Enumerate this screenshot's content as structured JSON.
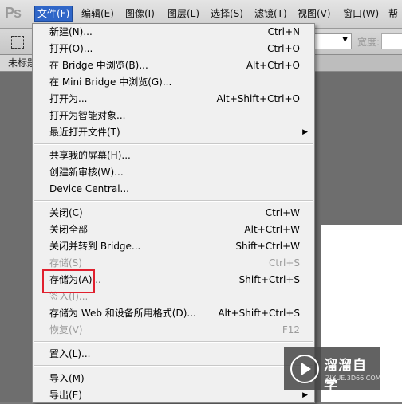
{
  "app": {
    "logo": "Ps"
  },
  "menubar": {
    "items": [
      {
        "label": "文件(F)"
      },
      {
        "label": "编辑(E)"
      },
      {
        "label": "图像(I)"
      },
      {
        "label": "图层(L)"
      },
      {
        "label": "选择(S)"
      },
      {
        "label": "滤镜(T)"
      },
      {
        "label": "视图(V)"
      },
      {
        "label": "窗口(W)"
      },
      {
        "label": "帮"
      }
    ]
  },
  "optionsbar": {
    "width_label": "宽度:"
  },
  "document": {
    "tab_label": "未标题"
  },
  "file_menu": {
    "items": [
      {
        "label": "新建(N)...",
        "shortcut": "Ctrl+N"
      },
      {
        "label": "打开(O)...",
        "shortcut": "Ctrl+O"
      },
      {
        "label": "在 Bridge 中浏览(B)...",
        "shortcut": "Alt+Ctrl+O"
      },
      {
        "label": "在 Mini Bridge 中浏览(G)...",
        "shortcut": ""
      },
      {
        "label": "打开为...",
        "shortcut": "Alt+Shift+Ctrl+O"
      },
      {
        "label": "打开为智能对象...",
        "shortcut": ""
      },
      {
        "label": "最近打开文件(T)",
        "shortcut": ""
      },
      {
        "label": "共享我的屏幕(H)...",
        "shortcut": ""
      },
      {
        "label": "创建新审核(W)...",
        "shortcut": ""
      },
      {
        "label": "Device Central...",
        "shortcut": ""
      },
      {
        "label": "关闭(C)",
        "shortcut": "Ctrl+W"
      },
      {
        "label": "关闭全部",
        "shortcut": "Alt+Ctrl+W"
      },
      {
        "label": "关闭并转到 Bridge...",
        "shortcut": "Shift+Ctrl+W"
      },
      {
        "label": "存储(S)",
        "shortcut": "Ctrl+S"
      },
      {
        "label": "存储为(A)...",
        "shortcut": "Shift+Ctrl+S"
      },
      {
        "label": "签入(I)...",
        "shortcut": ""
      },
      {
        "label": "存储为 Web 和设备所用格式(D)...",
        "shortcut": "Alt+Shift+Ctrl+S"
      },
      {
        "label": "恢复(V)",
        "shortcut": "F12"
      },
      {
        "label": "置入(L)...",
        "shortcut": ""
      },
      {
        "label": "导入(M)",
        "shortcut": ""
      },
      {
        "label": "导出(E)",
        "shortcut": ""
      }
    ]
  },
  "watermark": {
    "title": "溜溜自学",
    "subtitle": "ZIXUE.3D66.COM"
  }
}
